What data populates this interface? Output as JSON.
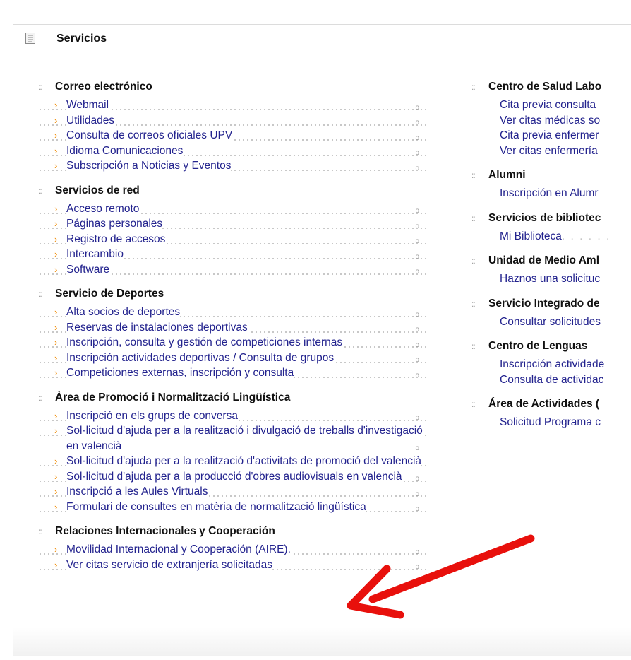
{
  "header": {
    "title": "Servicios",
    "icon": "document-icon"
  },
  "left_column": [
    {
      "title": "Correo electrónico",
      "items": [
        "Webmail",
        "Utilidades",
        "Consulta de correos oficiales UPV",
        "Idioma Comunicaciones",
        "Subscripción a Noticias y Eventos"
      ]
    },
    {
      "title": "Servicios de red",
      "items": [
        "Acceso remoto",
        "Páginas personales",
        "Registro de accesos",
        "Intercambio",
        "Software"
      ]
    },
    {
      "title": "Servicio de Deportes",
      "items": [
        "Alta socios de deportes",
        "Reservas de instalaciones deportivas",
        "Inscripción, consulta y gestión de competiciones internas",
        "Inscripción actividades deportivas / Consulta de grupos",
        "Competiciones externas, inscripción y consulta"
      ]
    },
    {
      "title": "Àrea de Promoció i Normalització Lingüística",
      "items": [
        "Inscripció en els grups de conversa",
        "Sol·licitud d'ajuda per a la realització i divulgació de treballs d'investigació en valencià",
        "Sol·licitud d'ajuda per a la realització d'activitats de promoció del valencià",
        "Sol·licitud d'ajuda per a la producció d'obres audiovisuals en valencià",
        "Inscripció a les Aules Virtuals",
        "Formulari de consultes en matèria de normalització lingüística"
      ]
    },
    {
      "title": "Relaciones Internacionales y Cooperación",
      "items": [
        "Movilidad Internacional y Cooperación (AIRE).",
        "Ver citas servicio de extranjería solicitadas"
      ]
    }
  ],
  "right_column": [
    {
      "title": "Centro de Salud Labo",
      "items": [
        "Cita previa consulta",
        "Ver citas médicas so",
        "Cita previa enfermer",
        "Ver citas enfermería"
      ]
    },
    {
      "title": "Alumni",
      "items": [
        "Inscripción en Alumr"
      ]
    },
    {
      "title": "Servicios de bibliotec",
      "items": [
        "Mi Biblioteca"
      ]
    },
    {
      "title": "Unidad de Medio Aml",
      "items": [
        "Haznos una solicituc"
      ]
    },
    {
      "title": "Servicio Integrado de",
      "items": [
        "Consultar solicitudes"
      ]
    },
    {
      "title": "Centro de Lenguas",
      "items": [
        "Inscripción actividade",
        "Consulta de actividac"
      ]
    },
    {
      "title": "Área de Actividades (",
      "items": [
        "Solicitud Programa c"
      ]
    }
  ],
  "colors": {
    "link": "#23238e",
    "chevron": "#f08a00",
    "arrow": "#e8100c"
  }
}
